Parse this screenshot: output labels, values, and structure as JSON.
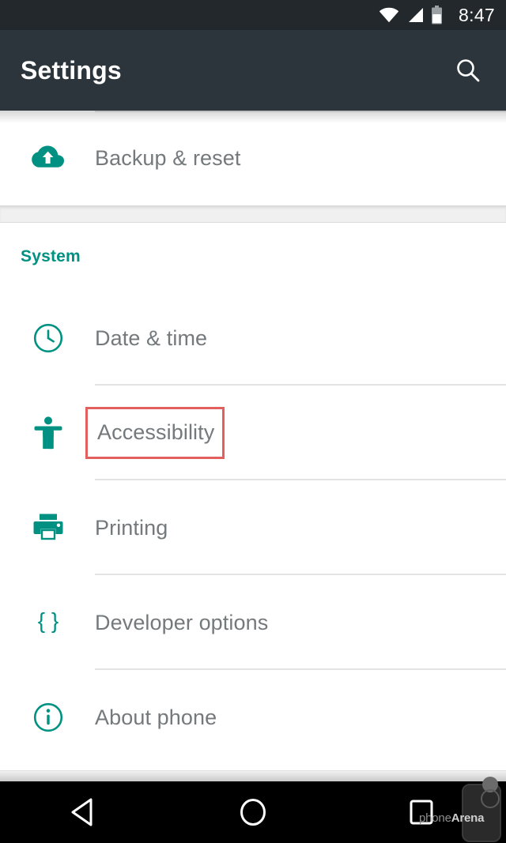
{
  "status_bar": {
    "time": "8:47",
    "icons": [
      "wifi-icon",
      "signal-icon",
      "battery-icon"
    ],
    "background_color": "#22282b"
  },
  "app_bar": {
    "title": "Settings",
    "search_icon": "search-icon",
    "background_color": "#2b353b"
  },
  "theme": {
    "accent_color": "#009183",
    "label_color": "#74797c",
    "highlight_color": "#e2615f",
    "divider_color": "#e2e3e4"
  },
  "list": {
    "top_partial_row": {
      "label": "Backup & reset",
      "icon": "cloud-upload-icon"
    },
    "sections": [
      {
        "header": "System",
        "items": [
          {
            "label": "Date & time",
            "icon": "clock-icon",
            "highlighted": false
          },
          {
            "label": "Accessibility",
            "icon": "accessibility-icon",
            "highlighted": true
          },
          {
            "label": "Printing",
            "icon": "printer-icon",
            "highlighted": false
          },
          {
            "label": "Developer options",
            "icon": "braces-icon",
            "highlighted": false
          },
          {
            "label": "About phone",
            "icon": "info-circle-icon",
            "highlighted": false
          }
        ]
      }
    ]
  },
  "nav_bar": {
    "buttons": [
      {
        "name": "back-button",
        "icon": "back-triangle-icon"
      },
      {
        "name": "home-button",
        "icon": "home-circle-icon"
      },
      {
        "name": "recents-button",
        "icon": "recents-square-icon"
      }
    ],
    "background_color": "#000000"
  },
  "watermark": {
    "text_light": "phone",
    "text_bold": "Arena"
  }
}
